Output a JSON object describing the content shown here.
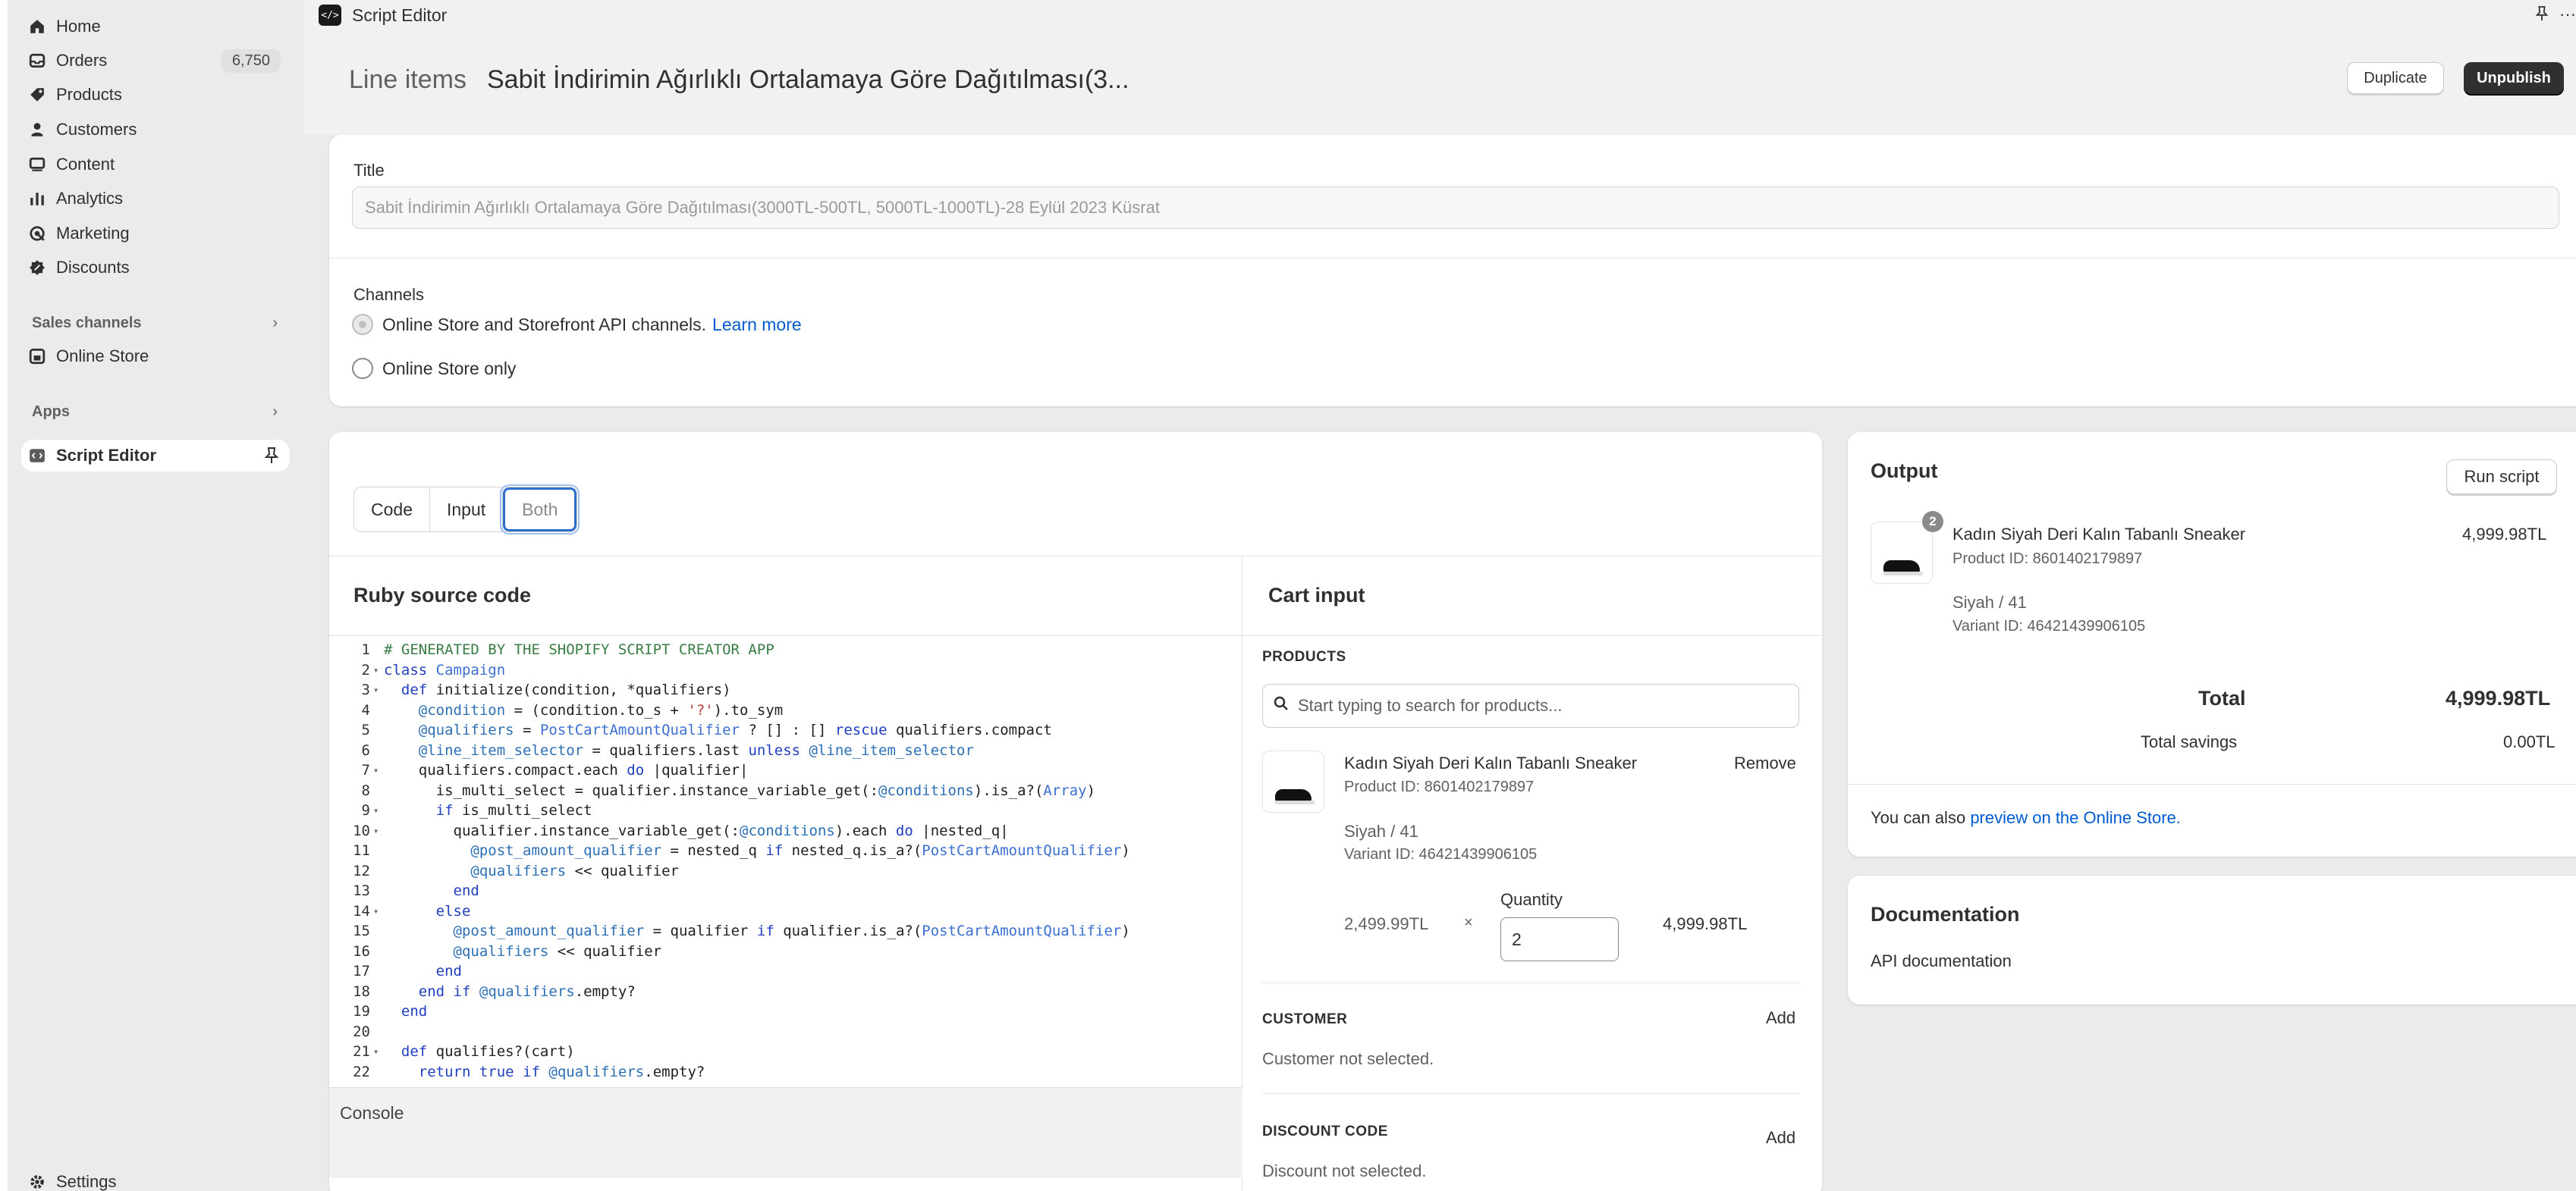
{
  "sidebar": {
    "items": [
      {
        "label": "Home",
        "icon": "home-icon"
      },
      {
        "label": "Orders",
        "icon": "orders-icon",
        "badge": "6,750"
      },
      {
        "label": "Products",
        "icon": "tag-icon"
      },
      {
        "label": "Customers",
        "icon": "person-icon"
      },
      {
        "label": "Content",
        "icon": "content-icon"
      },
      {
        "label": "Analytics",
        "icon": "analytics-icon"
      },
      {
        "label": "Marketing",
        "icon": "marketing-icon"
      },
      {
        "label": "Discounts",
        "icon": "discount-icon"
      }
    ],
    "sales_channels_label": "Sales channels",
    "online_store_label": "Online Store",
    "apps_label": "Apps",
    "script_editor_label": "Script Editor",
    "settings_label": "Settings"
  },
  "topbar": {
    "app_name": "Script Editor"
  },
  "header": {
    "breadcrumb": "Line items",
    "title": "Sabit İndirimin Ağırlıklı Ortalamaya Göre Dağıtılması(3...",
    "duplicate_label": "Duplicate",
    "unpublish_label": "Unpublish"
  },
  "title_card": {
    "label": "Title",
    "value": "Sabit İndirimin Ağırlıklı Ortalamaya Göre Dağıtılması(3000TL-500TL, 5000TL-1000TL)-28 Eylül 2023 Küsrat",
    "channels_label": "Channels",
    "option1": "Online Store and Storefront API channels.",
    "learn_more": "Learn more",
    "option2": "Online Store only"
  },
  "editor": {
    "tabs": [
      "Code",
      "Input",
      "Both"
    ],
    "active_tab": "Both",
    "source_title": "Ruby source code",
    "console_label": "Console",
    "lines": [
      {
        "n": "1",
        "fold": "",
        "code": "# GENERATED BY THE SHOPIFY SCRIPT CREATOR APP"
      },
      {
        "n": "2",
        "fold": "▾",
        "code": "class Campaign"
      },
      {
        "n": "3",
        "fold": "▾",
        "code": "  def initialize(condition, *qualifiers)"
      },
      {
        "n": "4",
        "fold": "",
        "code": "    @condition = (condition.to_s + '?').to_sym"
      },
      {
        "n": "5",
        "fold": "",
        "code": "    @qualifiers = PostCartAmountQualifier ? [] : [] rescue qualifiers.compact"
      },
      {
        "n": "6",
        "fold": "",
        "code": "    @line_item_selector = qualifiers.last unless @line_item_selector"
      },
      {
        "n": "7",
        "fold": "▾",
        "code": "    qualifiers.compact.each do |qualifier|"
      },
      {
        "n": "8",
        "fold": "",
        "code": "      is_multi_select = qualifier.instance_variable_get(:@conditions).is_a?(Array)"
      },
      {
        "n": "9",
        "fold": "▾",
        "code": "      if is_multi_select"
      },
      {
        "n": "10",
        "fold": "▾",
        "code": "        qualifier.instance_variable_get(:@conditions).each do |nested_q|"
      },
      {
        "n": "11",
        "fold": "",
        "code": "          @post_amount_qualifier = nested_q if nested_q.is_a?(PostCartAmountQualifier)"
      },
      {
        "n": "12",
        "fold": "",
        "code": "          @qualifiers << qualifier"
      },
      {
        "n": "13",
        "fold": "",
        "code": "        end"
      },
      {
        "n": "14",
        "fold": "▾",
        "code": "      else"
      },
      {
        "n": "15",
        "fold": "",
        "code": "        @post_amount_qualifier = qualifier if qualifier.is_a?(PostCartAmountQualifier)"
      },
      {
        "n": "16",
        "fold": "",
        "code": "        @qualifiers << qualifier"
      },
      {
        "n": "17",
        "fold": "",
        "code": "      end"
      },
      {
        "n": "18",
        "fold": "",
        "code": "    end if @qualifiers.empty?"
      },
      {
        "n": "19",
        "fold": "",
        "code": "  end"
      },
      {
        "n": "20",
        "fold": "",
        "code": ""
      },
      {
        "n": "21",
        "fold": "▾",
        "code": "  def qualifies?(cart)"
      },
      {
        "n": "22",
        "fold": "",
        "code": "    return true if @qualifiers.empty?"
      }
    ]
  },
  "cart_input": {
    "title": "Cart input",
    "products_label": "PRODUCTS",
    "search_placeholder": "Start typing to search for products...",
    "product_name": "Kadın Siyah Deri Kalın Tabanlı Sneaker",
    "remove_label": "Remove",
    "product_id": "Product ID: 8601402179897",
    "variant": "Siyah / 41",
    "variant_id": "Variant ID: 46421439906105",
    "unit_price": "2,499.99TL",
    "times": "×",
    "quantity_label": "Quantity",
    "quantity": "2",
    "line_total": "4,999.98TL",
    "customer_label": "CUSTOMER",
    "customer_add": "Add",
    "customer_status": "Customer not selected.",
    "discount_label": "DISCOUNT CODE",
    "discount_add": "Add",
    "discount_status": "Discount not selected."
  },
  "output": {
    "title": "Output",
    "run_label": "Run script",
    "count": "2",
    "product_name": "Kadın Siyah Deri Kalın Tabanlı Sneaker",
    "price": "4,999.98TL",
    "product_id": "Product ID: 8601402179897",
    "variant": "Siyah / 41",
    "variant_id": "Variant ID: 46421439906105",
    "total_label": "Total",
    "total_value": "4,999.98TL",
    "savings_label": "Total savings",
    "savings_value": "0.00TL",
    "also_text": "You can also",
    "preview_link": "preview on the Online Store."
  },
  "documentation": {
    "title": "Documentation",
    "link": "API documentation"
  },
  "colors": {
    "link": "#005bd3",
    "primary_button": "#303030",
    "background": "#ebebeb",
    "focus": "#2c6ecb"
  }
}
